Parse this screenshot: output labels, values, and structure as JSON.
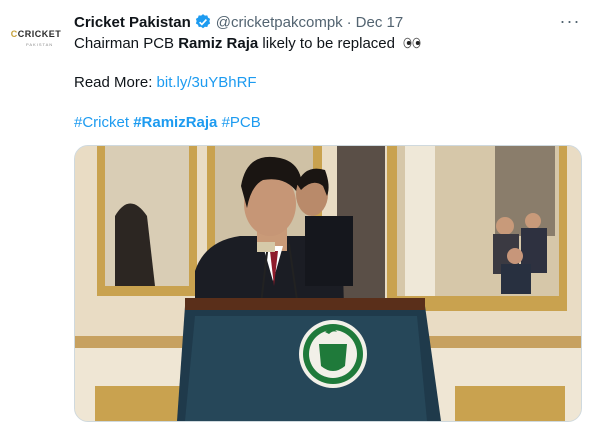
{
  "tweet": {
    "avatar_text": "CRICKET",
    "avatar_sub": "PAKISTAN",
    "author_name": "Cricket Pakistan",
    "handle": "@cricketpakcompk",
    "separator": "·",
    "date": "Dec 17",
    "more_label": "···",
    "text_pre": "Chairman PCB ",
    "text_bold": "Ramiz Raja",
    "text_post": " likely to be replaced",
    "read_more_label": "Read More: ",
    "link": "bit.ly/3uYBhRF",
    "hashtags": [
      "#Cricket",
      "#RamizRaja",
      "#PCB"
    ]
  },
  "colors": {
    "link": "#1d9bf0",
    "verified": "#1d9bf0",
    "secondary_text": "#536471"
  }
}
